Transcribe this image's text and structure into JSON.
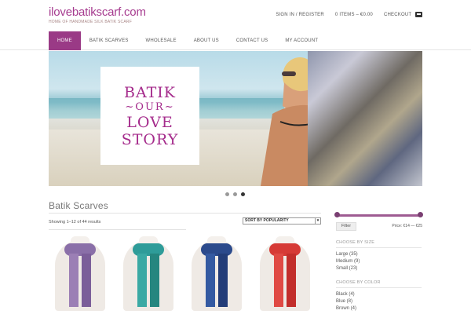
{
  "brand": {
    "title": "ilovebatikscarf.com",
    "tagline": "HOME OF HANDMADE SILK BATIK SCARF"
  },
  "top_links": {
    "sign_in": "SIGN IN / REGISTER",
    "cart": "0 ITEMS – €0.00",
    "checkout": "CHECKOUT"
  },
  "nav": [
    "HOME",
    "BATIK SCARVES",
    "WHOLESALE",
    "ABOUT US",
    "CONTACT US",
    "MY ACCOUNT"
  ],
  "hero": {
    "line1": "BATIK",
    "line2": "~OUR~",
    "line3": "LOVE",
    "line4": "STORY",
    "slide_count": 3,
    "active_slide": 3
  },
  "products": {
    "title": "Batik Scarves",
    "result_count": "Showing 1–12 of 44 results",
    "sort": "SORT BY POPULARITY"
  },
  "sidebar": {
    "filter_label": "Filter",
    "price": "Price: €14 — €25",
    "size_heading": "CHOOSE BY SIZE",
    "sizes": [
      "Large (35)",
      "Medium (9)",
      "Small (23)"
    ],
    "color_heading": "CHOOSE BY COLOR",
    "colors": [
      "Black (4)",
      "Blue (8)",
      "Brown (4)"
    ]
  },
  "colors": {
    "accent": "#9a3a86",
    "scarf1": "#8a6fa8",
    "scarf2": "#2e9c99",
    "scarf3": "#2b4a8c",
    "scarf4": "#d63a36"
  }
}
